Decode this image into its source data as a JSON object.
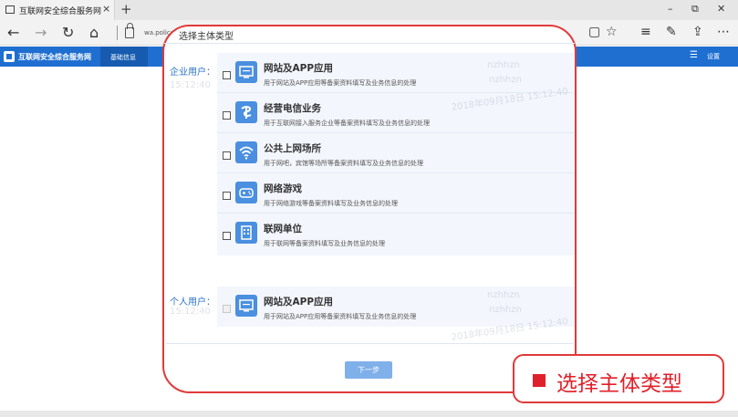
{
  "browser": {
    "tab_title": "互联网安全综合服务网",
    "tab_close": "×",
    "new_tab": "+",
    "url_text": "wa.police",
    "window_minimize": "–",
    "window_restore": "⧉",
    "window_close": "✕"
  },
  "site": {
    "name": "互联网安全综合服务网",
    "nav_tab": "基础信息",
    "settings_label": "设置"
  },
  "modal": {
    "title": "选择主体类型",
    "enterprise_label": "企业用户：",
    "personal_label": "个人用户：",
    "enterprise_items": [
      {
        "title": "网站及APP应用",
        "desc": "用于网站及APP应用等备案资料填写及业务信息的处理",
        "icon": "monitor-icon"
      },
      {
        "title": "经营电信业务",
        "desc": "用于互联网接入服务企业等备案资料填写及业务信息的处理",
        "icon": "telecom-icon"
      },
      {
        "title": "公共上网场所",
        "desc": "用于网吧，宾馆等场所等备案资料填写及业务信息的处理",
        "icon": "wifi-icon"
      },
      {
        "title": "网络游戏",
        "desc": "用于网络游戏等备案资料填写及业务信息的处理",
        "icon": "gamepad-icon"
      },
      {
        "title": "联网单位",
        "desc": "用于联网等备案资料填写及业务信息的处理",
        "icon": "building-icon"
      }
    ],
    "personal_items": [
      {
        "title": "网站及APP应用",
        "desc": "用于网站及APP应用等备案资料填写及业务信息的处理",
        "icon": "monitor-icon"
      }
    ],
    "next_button": "下一步",
    "watermark_user": "nzhhzn",
    "watermark_time": "2018年09月18日 15:12:40",
    "watermark_time_short": "15:12:40"
  },
  "callout": {
    "text": "选择主体类型"
  },
  "colors": {
    "accent": "#1f6fd1",
    "callout_red": "#e03a3a",
    "icon_blue": "#4a8fe0"
  }
}
